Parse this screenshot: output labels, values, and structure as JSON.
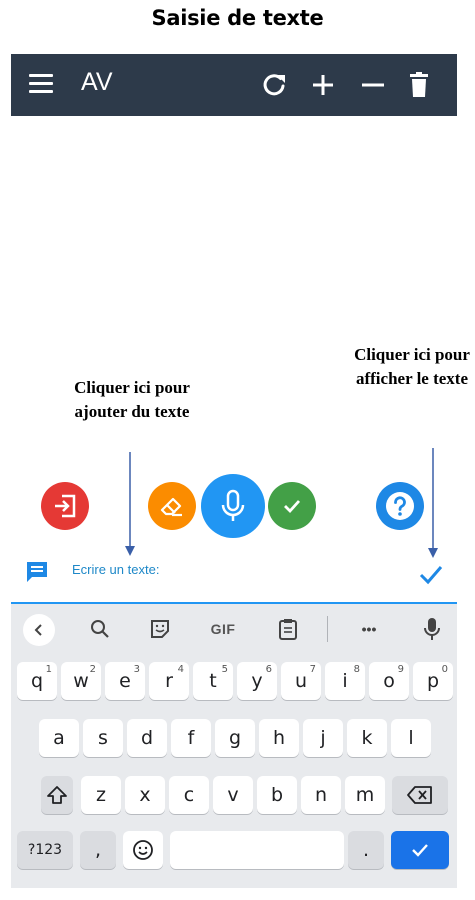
{
  "doc_title": "Saisie de texte",
  "appbar": {
    "title": "AV",
    "icons": [
      "menu-icon",
      "refresh-icon",
      "plus-icon",
      "minus-icon",
      "trash-icon"
    ]
  },
  "annotations": {
    "left": "Cliquer ici pour ajouter du texte",
    "right": "Cliquer ici pour afficher le texte"
  },
  "fabs": [
    "exit-icon",
    "eraser-icon",
    "microphone-icon",
    "check-icon",
    "help-icon"
  ],
  "colors": {
    "appbar": "#2d3a4a",
    "exit": "#e53935",
    "erase": "#fb8c00",
    "mic": "#2196f3",
    "check": "#43a047",
    "help": "#1e88e5",
    "keyboard_bg": "#e8eaed",
    "enter_key": "#1a73e8"
  },
  "input": {
    "placeholder": "Ecrire un texte:"
  },
  "keyboard": {
    "toolbar": {
      "gif_label": "GIF",
      "icons": [
        "back-icon",
        "search-icon",
        "sticker-icon",
        "gif-icon",
        "clipboard-icon",
        "more-icon",
        "mic-icon"
      ],
      "more_label": "•••"
    },
    "row1": [
      {
        "k": "q",
        "h": "1"
      },
      {
        "k": "w",
        "h": "2"
      },
      {
        "k": "e",
        "h": "3"
      },
      {
        "k": "r",
        "h": "4"
      },
      {
        "k": "t",
        "h": "5"
      },
      {
        "k": "y",
        "h": "6"
      },
      {
        "k": "u",
        "h": "7"
      },
      {
        "k": "i",
        "h": "8"
      },
      {
        "k": "o",
        "h": "9"
      },
      {
        "k": "p",
        "h": "0"
      }
    ],
    "row2": [
      "a",
      "s",
      "d",
      "f",
      "g",
      "h",
      "j",
      "k",
      "l"
    ],
    "row3": [
      "z",
      "x",
      "c",
      "v",
      "b",
      "n",
      "m"
    ],
    "bottom": {
      "numbers_label": "?123",
      "comma_label": ",",
      "period_label": "."
    }
  }
}
